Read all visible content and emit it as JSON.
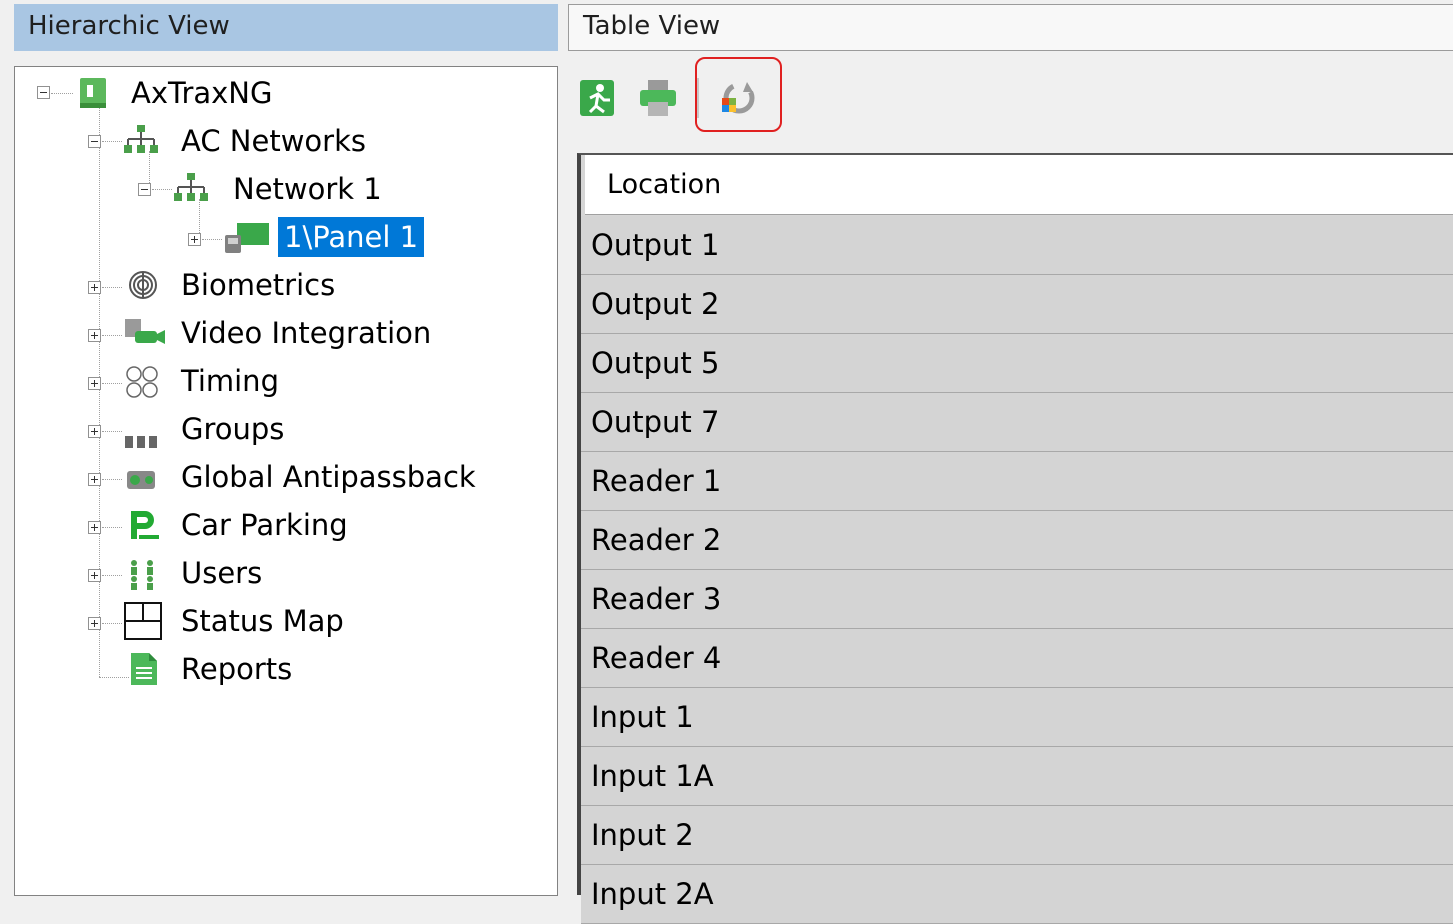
{
  "left_pane": {
    "title": "Hierarchic View",
    "tree": {
      "root": "AxTraxNG",
      "ac_networks": "AC Networks",
      "network_1": "Network 1",
      "panel_1": "1\\Panel 1",
      "biometrics": "Biometrics",
      "video_integration": "Video Integration",
      "timing": "Timing",
      "groups": "Groups",
      "global_antipassback": "Global Antipassback",
      "car_parking": "Car Parking",
      "users": "Users",
      "status_map": "Status Map",
      "reports": "Reports"
    }
  },
  "right_pane": {
    "title": "Table View",
    "toolbar": {
      "exit_icon": "exit-icon",
      "print_icon": "print-icon",
      "refresh_icon": "refresh-icon"
    },
    "table": {
      "column_header": "Location",
      "rows": [
        "Output 1",
        "Output 2",
        "Output 5",
        "Output 7",
        "Reader 1",
        "Reader 2",
        "Reader 3",
        "Reader 4",
        "Input 1",
        "Input 1A",
        "Input 2",
        "Input 2A"
      ]
    }
  },
  "colors": {
    "header_bg": "#a9c6e3",
    "selection": "#0078d7",
    "highlight_border": "#e02020",
    "accent_green": "#3aa84a"
  }
}
